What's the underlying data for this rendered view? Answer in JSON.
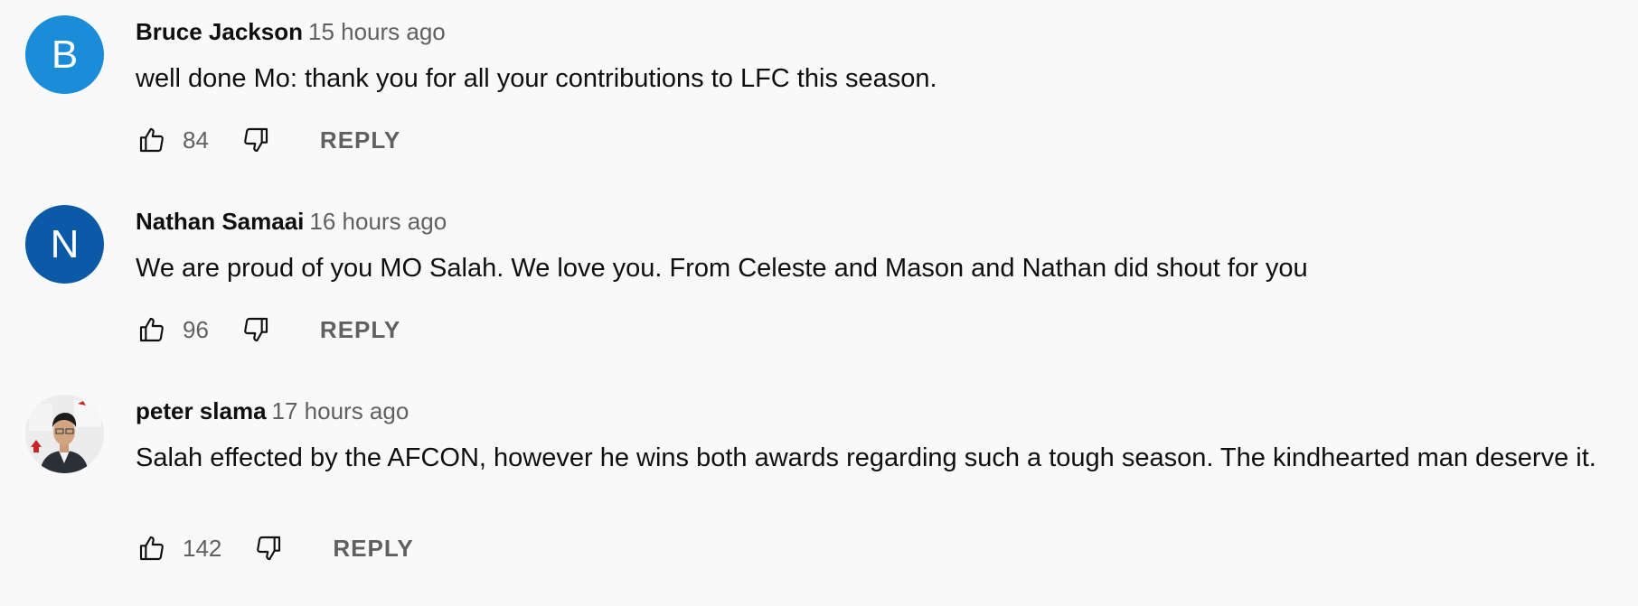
{
  "comments": [
    {
      "author": "Bruce Jackson",
      "time": "15 hours ago",
      "text": "well done Mo: thank you for all your contributions to LFC this season.",
      "likes": "84",
      "reply_label": "REPLY",
      "avatar_letter": "B",
      "avatar_color": "#1a8cd8"
    },
    {
      "author": "Nathan Samaai",
      "time": "16 hours ago",
      "text": "We are proud of you MO Salah. We love you. From Celeste and Mason and Nathan did shout for you",
      "likes": "96",
      "reply_label": "REPLY",
      "avatar_letter": "N",
      "avatar_color": "#0b5aa8"
    },
    {
      "author": "peter slama",
      "time": "17 hours ago",
      "text": "Salah effected by the AFCON, however he wins both awards regarding such a tough season. The kindhearted man deserve it.",
      "likes": "142",
      "reply_label": "REPLY",
      "avatar_letter": "",
      "avatar_color": "#e8e8e8"
    }
  ],
  "icons": {
    "like": "thumb-up-icon",
    "dislike": "thumb-down-icon"
  },
  "colors": {
    "background": "#f9f9f9",
    "text_primary": "#0f0f0f",
    "text_secondary": "#606060"
  }
}
